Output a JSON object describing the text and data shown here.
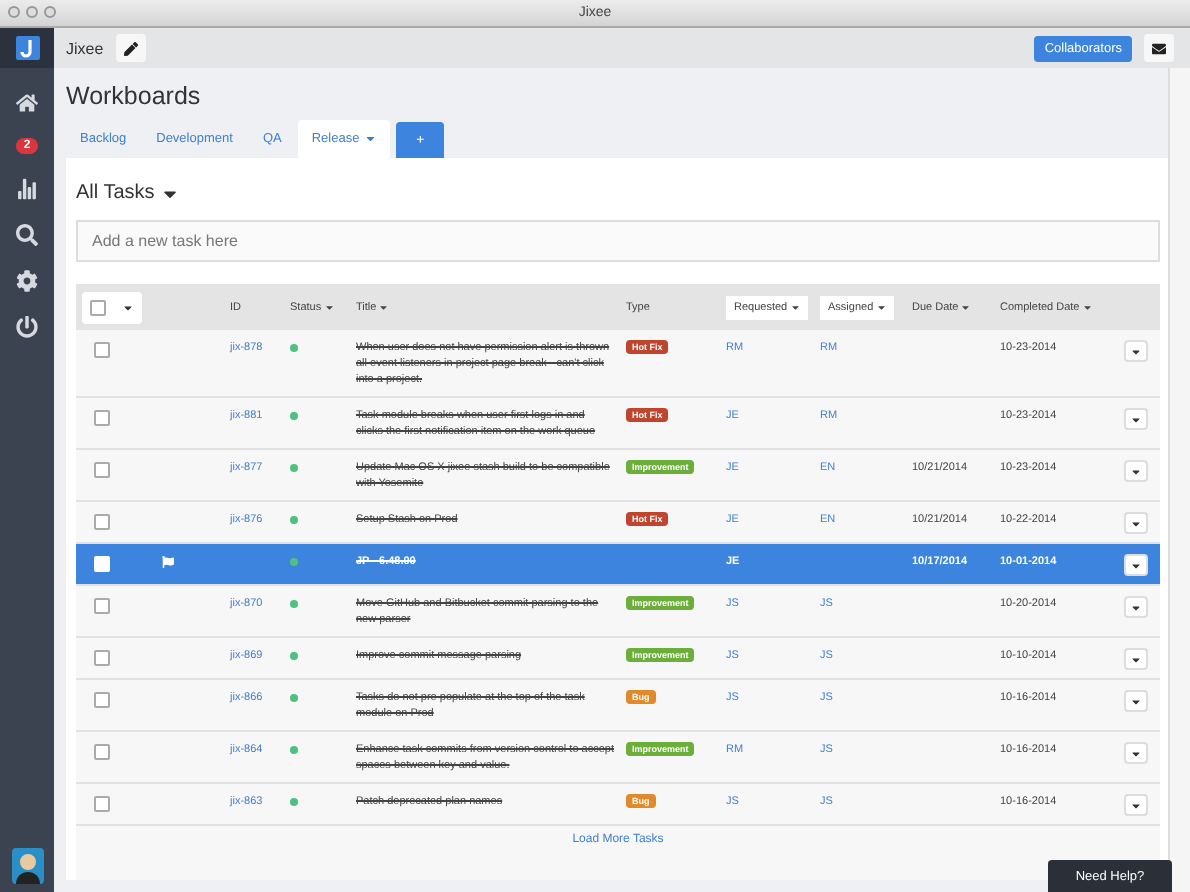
{
  "window": {
    "title": "Jixee"
  },
  "sidebar": {
    "badge": "2"
  },
  "topbar": {
    "project": "Jixee",
    "collaborators_button": "Collaborators"
  },
  "page_title": "Workboards",
  "tabs": [
    {
      "label": "Backlog",
      "selected": false,
      "dropdown": false
    },
    {
      "label": "Development",
      "selected": false,
      "dropdown": false
    },
    {
      "label": "QA",
      "selected": false,
      "dropdown": false
    },
    {
      "label": "Release",
      "selected": true,
      "dropdown": true
    }
  ],
  "add_tab_button": "+",
  "panel": {
    "title": "All Tasks",
    "new_task": {
      "placeholder": "Add a new task here"
    }
  },
  "table": {
    "select_all": {
      "checked": false
    },
    "columns": [
      {
        "label": "ID",
        "sortable": false,
        "boxed": false
      },
      {
        "label": "Status",
        "sortable": true,
        "boxed": false
      },
      {
        "label": "Title",
        "sortable": true,
        "boxed": false
      },
      {
        "label": "Type",
        "sortable": false,
        "boxed": false
      },
      {
        "label": "Requested",
        "sortable": true,
        "boxed": true
      },
      {
        "label": "Assigned",
        "sortable": true,
        "boxed": true
      },
      {
        "label": "Due Date",
        "sortable": true,
        "boxed": false
      },
      {
        "label": "Completed Date",
        "sortable": true,
        "boxed": false
      }
    ],
    "rows": [
      {
        "id": "jix-878",
        "title": "When user does not have permission alert is thrown all event listeners in project page break - can't click into a project.",
        "type": {
          "kind": "hotfix",
          "label": "Hot Fix"
        },
        "requested": "RM",
        "assigned": "RM",
        "due": "",
        "completed": "10-23-2014",
        "selected": false,
        "flagged": false,
        "done": true
      },
      {
        "id": "jix-881",
        "title": "Task module breaks when user first logs in and clicks the first notification item on the work queue",
        "type": {
          "kind": "hotfix",
          "label": "Hot Fix"
        },
        "requested": "JE",
        "assigned": "RM",
        "due": "",
        "completed": "10-23-2014",
        "selected": false,
        "flagged": false,
        "done": true
      },
      {
        "id": "jix-877",
        "title": "Update Mac OS X jixee stash build to be compatible with Yosemite",
        "type": {
          "kind": "improvement",
          "label": "Improvement"
        },
        "requested": "JE",
        "assigned": "EN",
        "due": "10/21/2014",
        "completed": "10-23-2014",
        "selected": false,
        "flagged": false,
        "done": true
      },
      {
        "id": "jix-876",
        "title": "Setup Stash on Prod",
        "type": {
          "kind": "hotfix",
          "label": "Hot Fix"
        },
        "requested": "JE",
        "assigned": "EN",
        "due": "10/21/2014",
        "completed": "10-22-2014",
        "selected": false,
        "flagged": false,
        "done": true
      },
      {
        "id": "",
        "title": "JP - 6.48.00",
        "type": null,
        "requested": "JE",
        "assigned": "",
        "due": "10/17/2014",
        "completed": "10-01-2014",
        "selected": true,
        "flagged": true,
        "done": true
      },
      {
        "id": "jix-870",
        "title": "Move GitHub and Bitbucket commit parsing to the new parser",
        "type": {
          "kind": "improvement",
          "label": "Improvement"
        },
        "requested": "JS",
        "assigned": "JS",
        "due": "",
        "completed": "10-20-2014",
        "selected": false,
        "flagged": false,
        "done": true
      },
      {
        "id": "jix-869",
        "title": "Improve commit message parsing",
        "type": {
          "kind": "improvement",
          "label": "Improvement"
        },
        "requested": "JS",
        "assigned": "JS",
        "due": "",
        "completed": "10-10-2014",
        "selected": false,
        "flagged": false,
        "done": true
      },
      {
        "id": "jix-866",
        "title": "Tasks do not pre populate at the top of the task module on Prod",
        "type": {
          "kind": "bug",
          "label": "Bug"
        },
        "requested": "JS",
        "assigned": "JS",
        "due": "",
        "completed": "10-16-2014",
        "selected": false,
        "flagged": false,
        "done": true
      },
      {
        "id": "jix-864",
        "title": "Enhance task commits from version control to accept spaces between key and value.",
        "type": {
          "kind": "improvement",
          "label": "Improvement"
        },
        "requested": "RM",
        "assigned": "JS",
        "due": "",
        "completed": "10-16-2014",
        "selected": false,
        "flagged": false,
        "done": true
      },
      {
        "id": "jix-863",
        "title": "Patch deprecated plan names",
        "type": {
          "kind": "bug",
          "label": "Bug"
        },
        "requested": "JS",
        "assigned": "JS",
        "due": "",
        "completed": "10-16-2014",
        "selected": false,
        "flagged": false,
        "done": true
      }
    ]
  },
  "load_more": "Load More Tasks",
  "help_button": "Need Help?"
}
